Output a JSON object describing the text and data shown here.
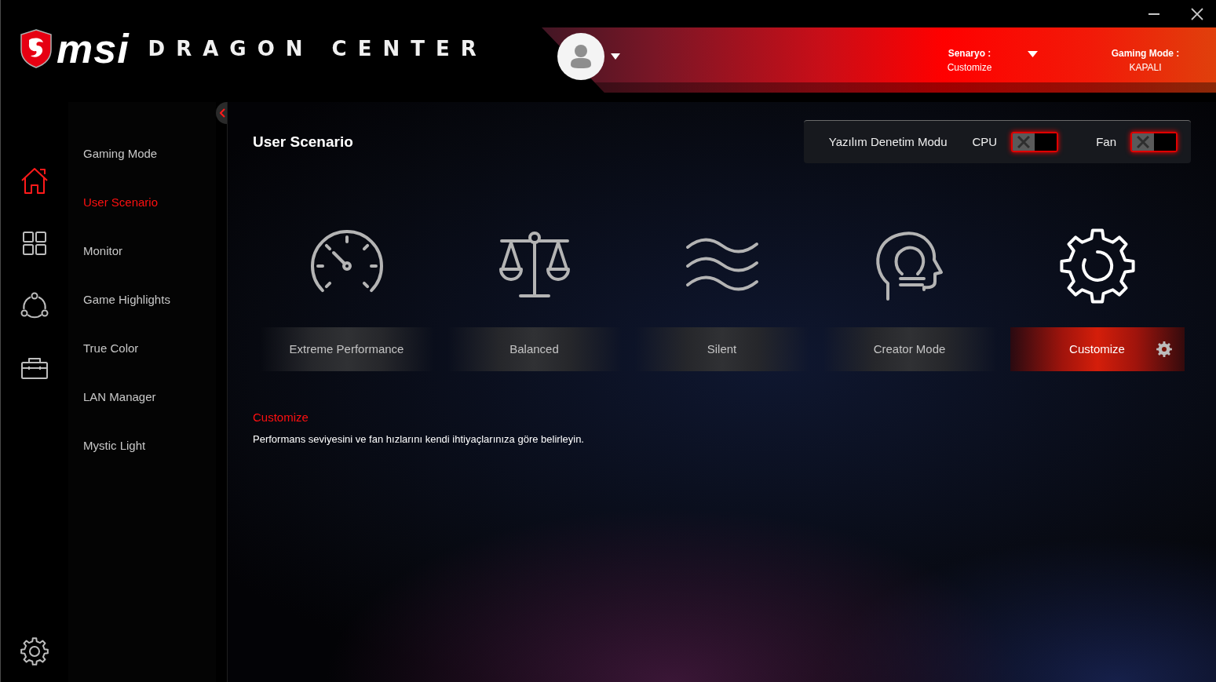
{
  "app": {
    "brand": "msi",
    "title": "DRAGON CENTER"
  },
  "header": {
    "scenario": {
      "label": "Senaryo :",
      "value": "Customize"
    },
    "gaming_mode": {
      "label": "Gaming Mode :",
      "value": "KAPALI"
    }
  },
  "sidebar": {
    "icons": [
      {
        "kind": "home",
        "selected": true
      },
      {
        "kind": "grid",
        "selected": false
      },
      {
        "kind": "share",
        "selected": false
      },
      {
        "kind": "toolbox",
        "selected": false
      }
    ],
    "menu": [
      {
        "label": "Gaming Mode",
        "selected": false
      },
      {
        "label": "User Scenario",
        "selected": true
      },
      {
        "label": "Monitor",
        "selected": false
      },
      {
        "label": "Game Highlights",
        "selected": false
      },
      {
        "label": "True Color",
        "selected": false
      },
      {
        "label": "LAN Manager",
        "selected": false
      },
      {
        "label": "Mystic Light",
        "selected": false
      }
    ]
  },
  "page": {
    "title": "User Scenario",
    "control_panel": {
      "label": "Yazılım Denetim Modu",
      "toggles": [
        {
          "label": "CPU",
          "on": false
        },
        {
          "label": "Fan",
          "on": false
        }
      ]
    },
    "scenarios": [
      {
        "kind": "gauge",
        "label": "Extreme Performance",
        "selected": false
      },
      {
        "kind": "scale",
        "label": "Balanced",
        "selected": false
      },
      {
        "kind": "waves",
        "label": "Silent",
        "selected": false
      },
      {
        "kind": "head",
        "label": "Creator Mode",
        "selected": false
      },
      {
        "kind": "custom",
        "label": "Customize",
        "selected": true
      }
    ],
    "description": {
      "title": "Customize",
      "text": "Performans seviyesini ve fan hızlarını kendi ihtiyaçlarınıza göre belirleyin."
    }
  }
}
